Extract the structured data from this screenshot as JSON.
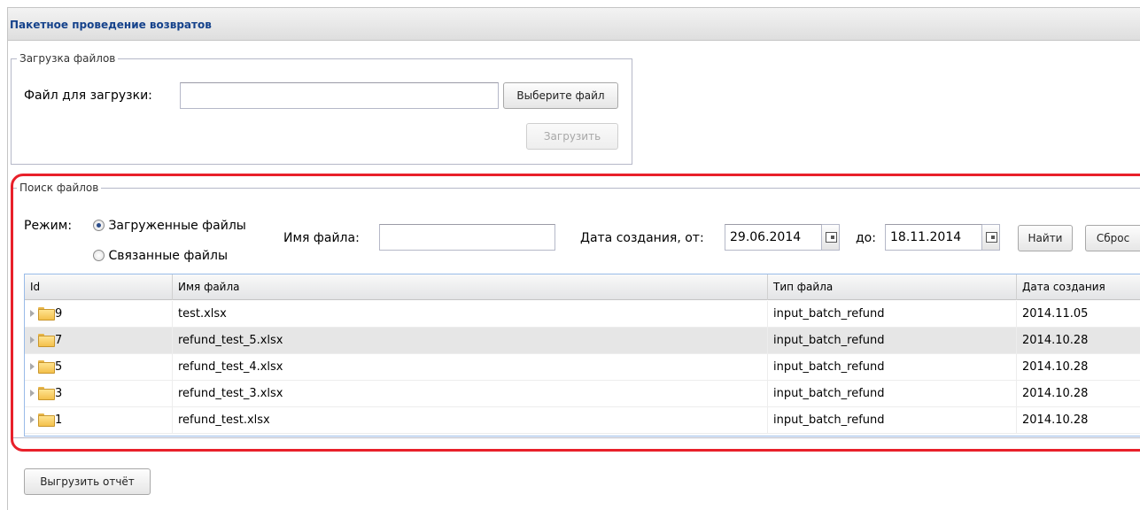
{
  "panel": {
    "title": "Пакетное проведение возвратов"
  },
  "upload": {
    "legend": "Загрузка файлов",
    "file_label": "Файл для загрузки:",
    "file_value": "",
    "choose_button": "Выберите файл",
    "upload_button": "Загрузить"
  },
  "search": {
    "legend": "Поиск файлов",
    "mode_label": "Режим:",
    "mode_options": [
      {
        "label": "Загруженные файлы",
        "checked": true
      },
      {
        "label": "Связанные файлы",
        "checked": false
      }
    ],
    "filename_label": "Имя файла:",
    "filename_value": "",
    "date_from_label": "Дата создания, от:",
    "date_from_value": "29.06.2014",
    "date_to_label": "до:",
    "date_to_value": "18.11.2014",
    "find_button": "Найти",
    "reset_button": "Сброс"
  },
  "grid": {
    "columns": [
      "Id",
      "Имя файла",
      "Тип файла",
      "Дата создания"
    ],
    "rows": [
      {
        "id": "9",
        "name": "test.xlsx",
        "type": "input_batch_refund",
        "date": "2014.11.05"
      },
      {
        "id": "7",
        "name": "refund_test_5.xlsx",
        "type": "input_batch_refund",
        "date": "2014.10.28"
      },
      {
        "id": "5",
        "name": "refund_test_4.xlsx",
        "type": "input_batch_refund",
        "date": "2014.10.28"
      },
      {
        "id": "3",
        "name": "refund_test_3.xlsx",
        "type": "input_batch_refund",
        "date": "2014.10.28"
      },
      {
        "id": "1",
        "name": "refund_test.xlsx",
        "type": "input_batch_refund",
        "date": "2014.10.28"
      }
    ]
  },
  "footer": {
    "export_button": "Выгрузить отчёт"
  },
  "icons": {
    "row": "folder-icon",
    "expander": "expander-arrow-icon",
    "calendar": "calendar-icon"
  },
  "colors": {
    "highlight": "#e8202a",
    "header_text": "#15428b",
    "grid_border": "#99bbe8"
  }
}
